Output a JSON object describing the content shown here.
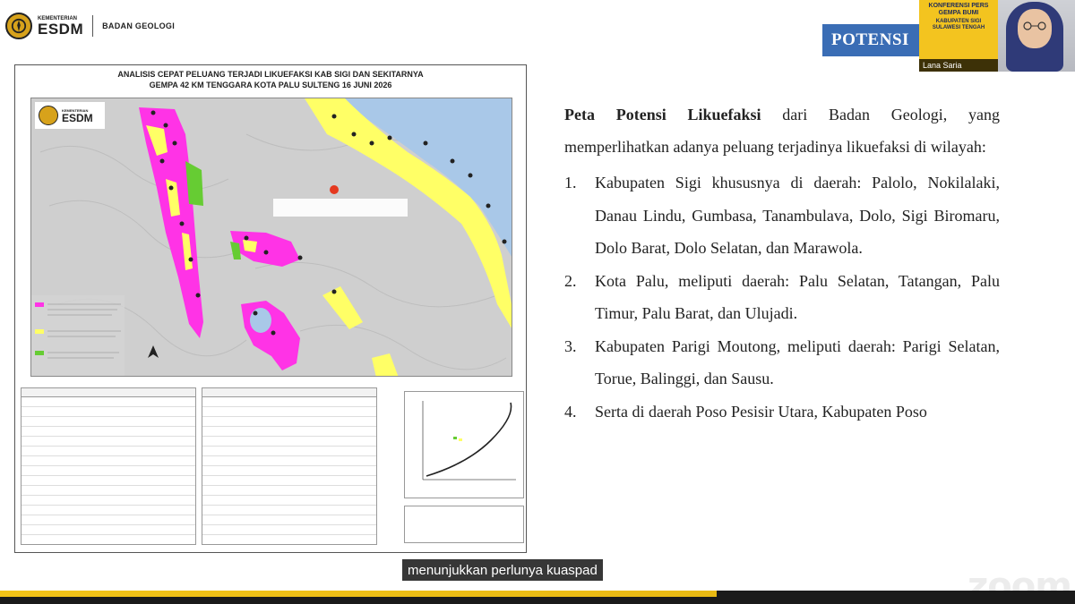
{
  "header": {
    "ministry_small": "KEMENTERIAN",
    "ministry_big": "ESDM",
    "agency": "BADAN GEOLOGI",
    "section_badge": "POTENSI"
  },
  "webcam": {
    "card_line1": "KONFERENSI PERS GEMPA BUMI",
    "card_line2": "KABUPATEN SIGI SULAWESI TENGAH",
    "participant_name": "Lana Saria"
  },
  "map": {
    "title_line1": "ANALISIS CEPAT PELUANG TERJADI LIKUEFAKSI KAB SIGI DAN SEKITARNYA",
    "title_line2": "GEMPA 42 KM TENGGARA KOTA PALU SULTENG 16 JUNI 2026",
    "logo_small": "KEMENTERIAN",
    "logo_big": "ESDM",
    "colors": {
      "high": "#ff33e6",
      "medium": "#ffff66",
      "low": "#66cc33",
      "sea": "#a9c8e8",
      "land": "#d9d9d9"
    }
  },
  "content": {
    "intro_bold": "Peta Potensi Likuefaksi",
    "intro_rest": " dari Badan Geologi, yang memperlihatkan adanya peluang terjadinya likuefaksi di wilayah:",
    "items": [
      {
        "num": "1.",
        "text": "Kabupaten Sigi khususnya di daerah: Palolo, Nokilalaki, Danau Lindu, Gumbasa, Tanambulava, Dolo, Sigi Biromaru, Dolo Barat, Dolo Selatan, dan Marawola."
      },
      {
        "num": "2.",
        "text": "Kota Palu, meliputi daerah: Palu Selatan, Tatangan, Palu Timur, Palu Barat, dan Ulujadi."
      },
      {
        "num": "3.",
        "text": "Kabupaten Parigi Moutong, meliputi daerah: Parigi Selatan, Torue, Balinggi, dan Sausu."
      },
      {
        "num": "4.",
        "text": "Serta di daerah Poso Pesisir Utara, Kabupaten Poso"
      }
    ]
  },
  "caption": "menunjukkan perlunya kuaspad",
  "watermark": "zoom"
}
